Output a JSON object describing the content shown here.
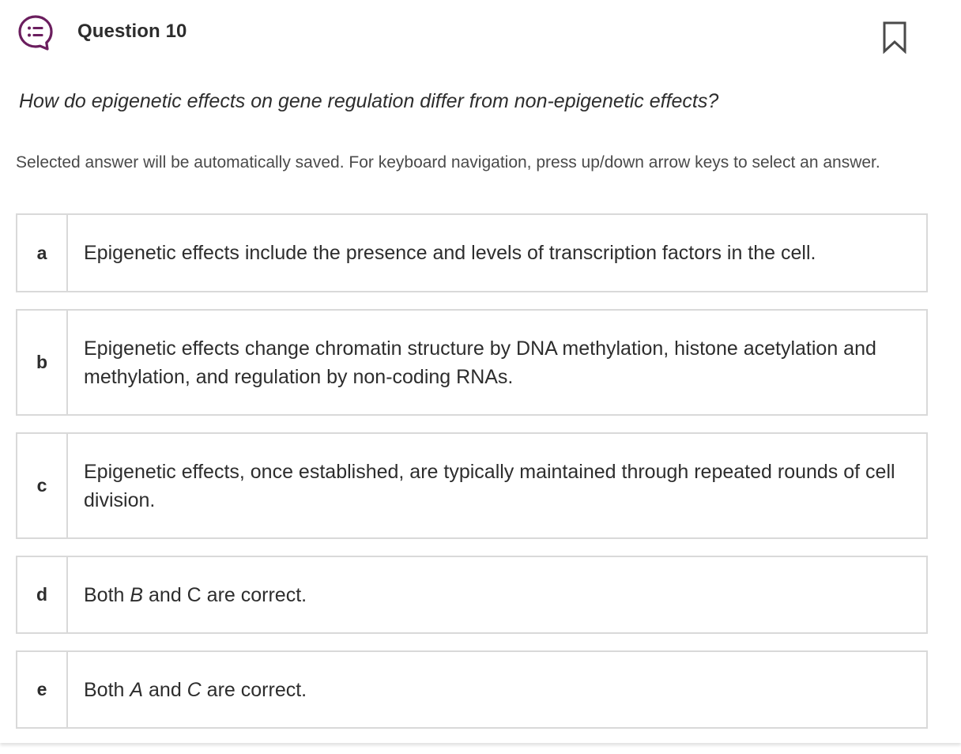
{
  "question": {
    "title": "Question 10",
    "icon": "chat-list-icon",
    "bookmark_icon": "bookmark-icon",
    "prompt": "How do epigenetic effects on gene regulation differ from non-epigenetic effects?",
    "instructions": "Selected answer will be automatically saved. For keyboard navigation, press up/down arrow keys to select an answer."
  },
  "colors": {
    "accent": "#6b1e5e",
    "border": "#d9d9d9",
    "text": "#2d2d2d"
  },
  "options": [
    {
      "letter": "a",
      "text": "Epigenetic effects include the presence and levels of transcription factors in the cell."
    },
    {
      "letter": "b",
      "text": "Epigenetic effects change chromatin structure by DNA methylation, histone acetylation and methylation, and regulation by non-coding RNAs."
    },
    {
      "letter": "c",
      "text": "Epigenetic effects, once established, are typically maintained through repeated rounds of cell division."
    },
    {
      "letter": "d",
      "text_pre": "Both ",
      "text_em": "B",
      "text_post": " and C are correct."
    },
    {
      "letter": "e",
      "text_pre": "Both ",
      "text_em1": "A",
      "text_mid": " and ",
      "text_em2": "C",
      "text_post": " are correct."
    }
  ]
}
